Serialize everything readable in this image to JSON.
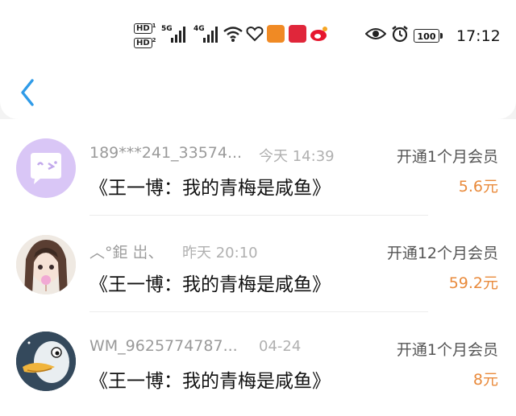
{
  "status_bar": {
    "hd1": "HD",
    "hd2": "HD",
    "net5g": "5G",
    "net4g": "4G",
    "battery": "100",
    "time": "17:12"
  },
  "records": [
    {
      "username": "189***241_33574...",
      "time": "今天 14:39",
      "title": "《王一博：我的青梅是咸鱼》",
      "description": "开通1个月会员",
      "amount": "5.6元"
    },
    {
      "username": "︿°鉅 岀、",
      "time": "昨天 20:10",
      "title": "《王一博：我的青梅是咸鱼》",
      "description": "开通12个月会员",
      "amount": "59.2元"
    },
    {
      "username": "WM_9625774787...",
      "time": "04-24",
      "title": "《王一博：我的青梅是咸鱼》",
      "description": "开通1个月会员",
      "amount": "8元"
    }
  ],
  "colors": {
    "accent": "#2f9be8",
    "amount": "#e98a3b"
  }
}
